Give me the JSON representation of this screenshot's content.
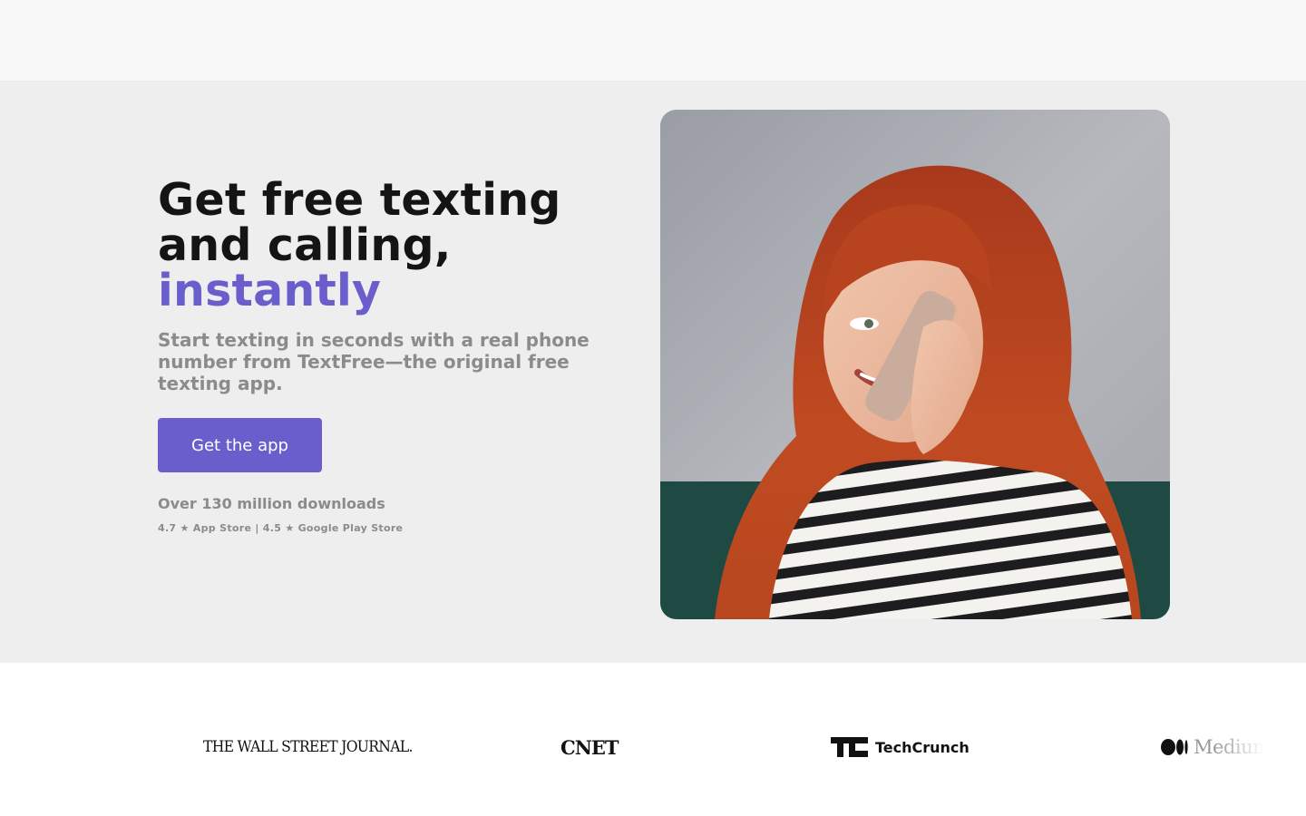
{
  "hero": {
    "headline_line1": "Get free texting",
    "headline_line2": "and calling,",
    "headline_accent": "instantly",
    "subtext": "Start texting in seconds with a real phone number from TextFree—the original free texting app.",
    "cta_label": "Get the app",
    "downloads": "Over 130 million downloads",
    "ratings": "4.7 ★ App Store | 4.5 ★ Google Play Store"
  },
  "press_logos": {
    "wsj": "THE WALL STREET JOURNAL.",
    "cnet": "CNET",
    "techcrunch": "TechCrunch",
    "medium": "Medium"
  },
  "colors": {
    "accent": "#6a5ecc",
    "hero_background": "#eeeeee",
    "headline": "#141414",
    "muted_text": "#8b8b8b"
  }
}
